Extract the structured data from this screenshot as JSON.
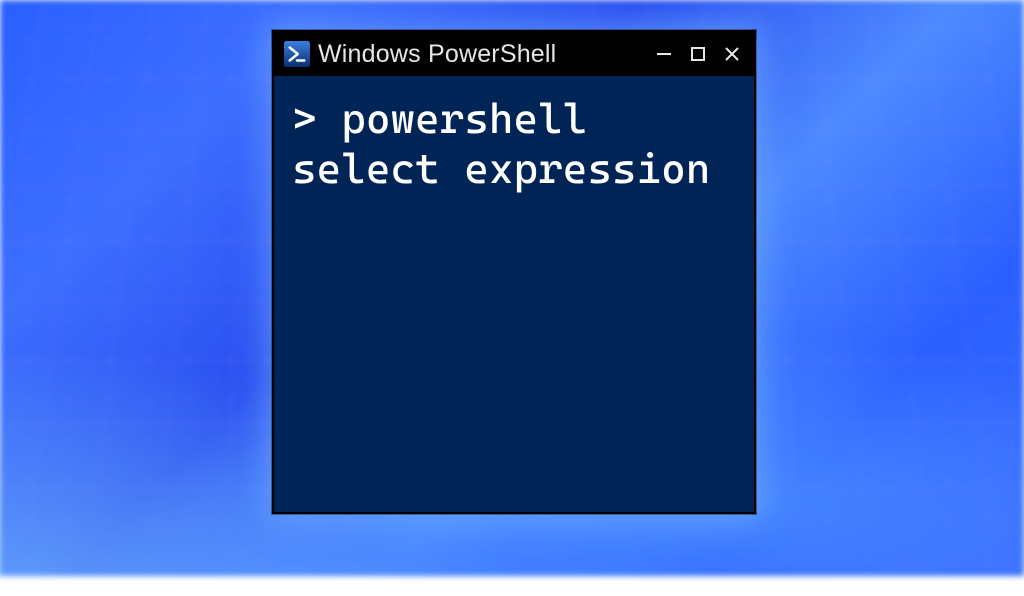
{
  "window": {
    "title": "Windows PowerShell",
    "icon": "powershell-icon"
  },
  "controls": {
    "minimize": "—",
    "maximize": "▢",
    "close": "✕"
  },
  "terminal": {
    "prompt": ">",
    "command": "powershell select expression"
  },
  "colors": {
    "terminal_bg": "#012456",
    "titlebar_bg": "#000000",
    "text": "#ffffff",
    "ps_icon_bg": "#0a3a8a"
  }
}
